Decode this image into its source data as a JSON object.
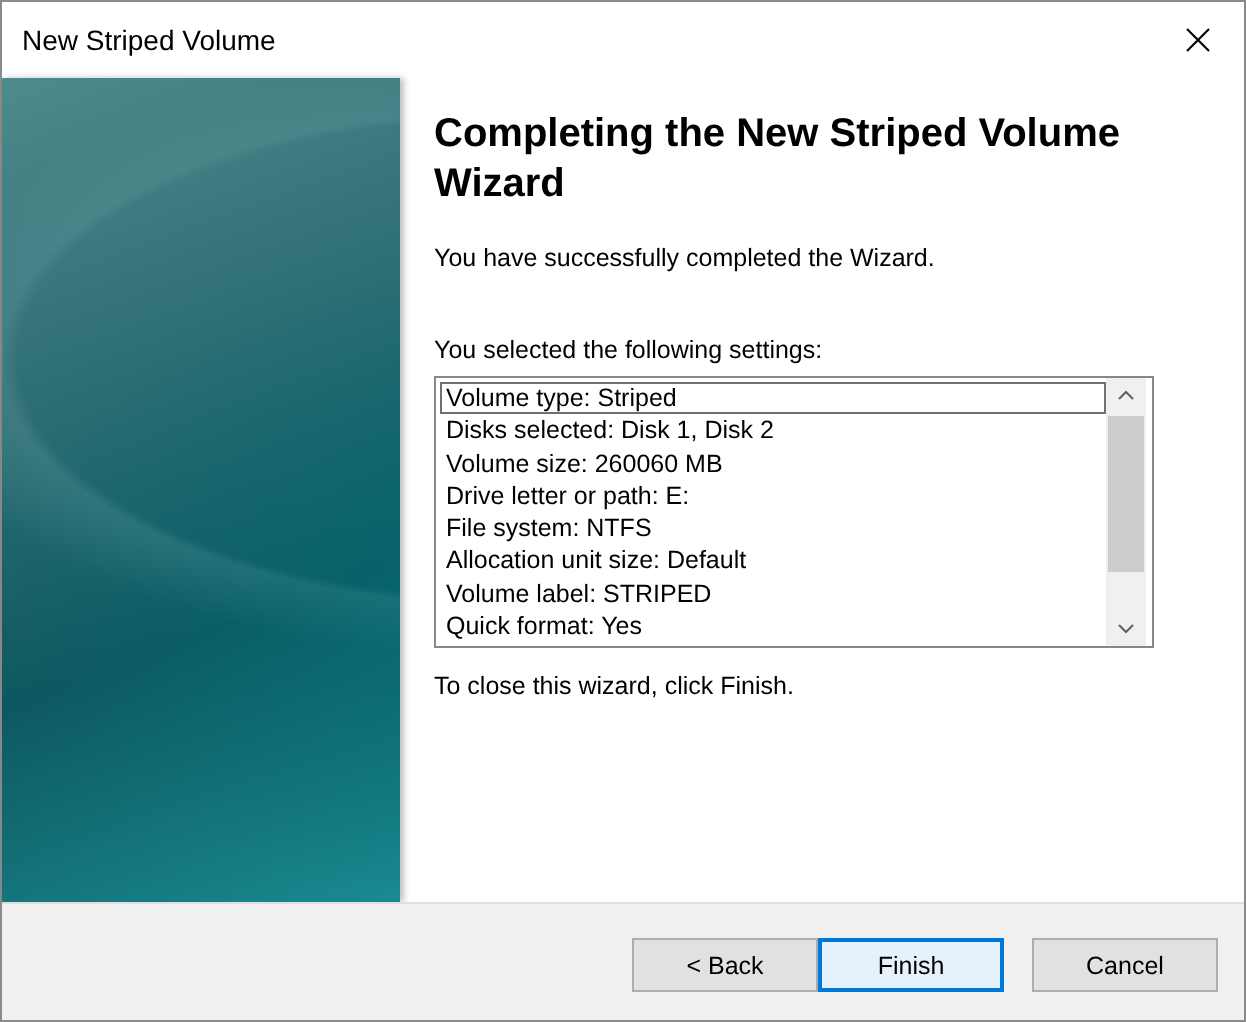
{
  "window": {
    "title": "New Striped Volume"
  },
  "heading": "Completing the New Striped Volume Wizard",
  "message": "You have successfully completed the Wizard.",
  "settings_label": "You selected the following settings:",
  "settings": [
    {
      "text": "Volume type: Striped",
      "selected": true
    },
    {
      "text": "Disks selected: Disk 1, Disk 2",
      "selected": false
    },
    {
      "text": "Volume size: 260060 MB",
      "selected": false
    },
    {
      "text": "Drive letter or path: E:",
      "selected": false
    },
    {
      "text": "File system: NTFS",
      "selected": false
    },
    {
      "text": "Allocation unit size: Default",
      "selected": false
    },
    {
      "text": "Volume label: STRIPED",
      "selected": false
    },
    {
      "text": "Quick format: Yes",
      "selected": false
    }
  ],
  "closing_note": "To close this wizard, click Finish.",
  "buttons": [
    {
      "label": "< Back",
      "default": false
    },
    {
      "label": "Finish",
      "default": true
    },
    {
      "label": "Cancel",
      "default": false
    }
  ]
}
